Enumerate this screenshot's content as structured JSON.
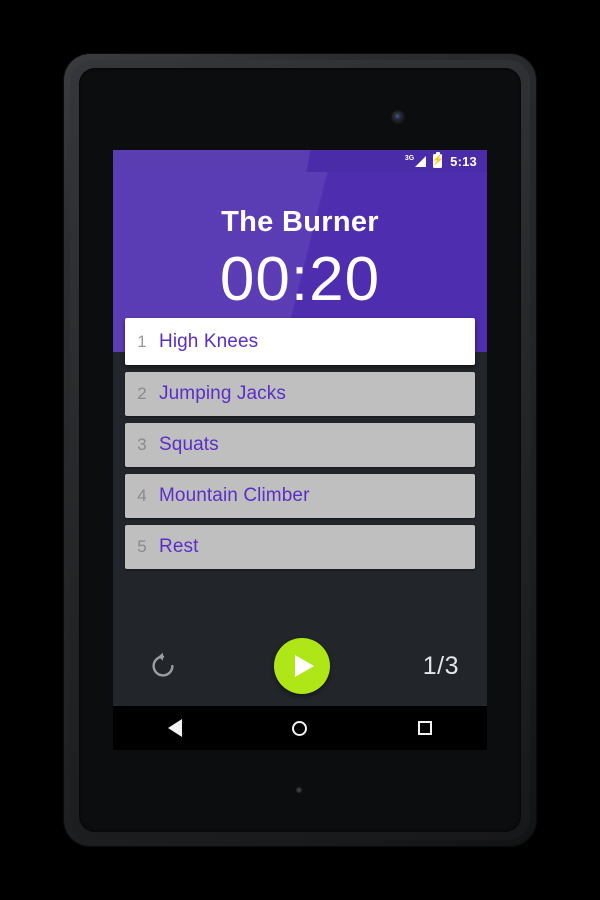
{
  "device": {
    "front_camera_icon": "camera-icon",
    "bottom_dot_icon": "microphone-dot-icon"
  },
  "status_bar": {
    "network_label": "3G",
    "signal_icon": "signal-bars-icon",
    "battery_icon": "battery-charging-icon",
    "battery_bolt": "⚡",
    "time": "5:13",
    "background_color": "#4a2ba8"
  },
  "header": {
    "workout_title": "The Burner",
    "timer": "00:20",
    "background_color": "#4e2daf"
  },
  "exercise_list": {
    "rows": [
      {
        "index": "1",
        "name": "High Knees",
        "active": true
      },
      {
        "index": "2",
        "name": "Jumping Jacks",
        "active": false
      },
      {
        "index": "3",
        "name": "Squats",
        "active": false
      },
      {
        "index": "4",
        "name": "Mountain Climber",
        "active": false
      },
      {
        "index": "5",
        "name": "Rest",
        "active": false
      }
    ],
    "active_background_color": "#ffffff",
    "inactive_background_color": "#bfbfbf",
    "name_color": "#5b2ec6",
    "index_color": "#8a8a8a"
  },
  "controls": {
    "restart_icon": "restart-icon",
    "play_icon": "play-icon",
    "play_button_color": "#aee617",
    "round_counter": "1/3"
  },
  "nav_bar": {
    "back_icon": "back-triangle-icon",
    "home_icon": "home-circle-icon",
    "recents_icon": "recents-square-icon"
  },
  "app_background_color": "#22262b"
}
